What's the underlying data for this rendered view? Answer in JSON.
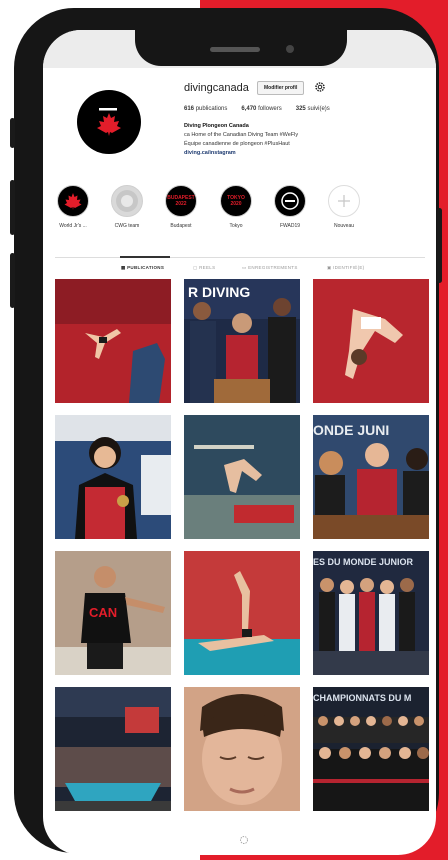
{
  "profile": {
    "username": "divingcanada",
    "edit_button": "Modifier profil",
    "stats": {
      "posts_count": "616",
      "posts_label": "publications",
      "followers_count": "6,470",
      "followers_label": "followers",
      "following_count": "325",
      "following_label": "suivi(e)s"
    },
    "bio": {
      "name": "Diving Plongeon Canada",
      "line1": "ca Home of the Canadian Diving Team #WeFly",
      "line2": "Équipe canadienne de plongeon #PlusHaut",
      "link": "diving.ca/instagram"
    }
  },
  "highlights": [
    {
      "label": "World Jr's ...",
      "icon": "maple-leaf"
    },
    {
      "label": "CWG team",
      "icon": "photo"
    },
    {
      "label": "Budapest",
      "icon": "text",
      "text": "BUDAPEST 2022"
    },
    {
      "label": "Tokyo",
      "icon": "text",
      "text": "TOKYO 2020"
    },
    {
      "label": "FWAD19",
      "icon": "logo"
    },
    {
      "label": "Nouveau",
      "icon": "plus"
    }
  ],
  "tabs": [
    {
      "label": "PUBLICATIONS",
      "icon": "grid-icon",
      "active": true
    },
    {
      "label": "REELS",
      "icon": "reels-icon",
      "active": false
    },
    {
      "label": "ENREGISTREMENTS",
      "icon": "bookmark-icon",
      "active": false
    },
    {
      "label": "IDENTIFIÉ(E)",
      "icon": "tag-icon",
      "active": false
    }
  ],
  "posts": [
    {
      "name": "post-diver-platform",
      "bg": "#b3232b"
    },
    {
      "name": "post-medal-trio",
      "bg": "#1e2a46"
    },
    {
      "name": "post-diver-pike",
      "bg": "#b8262e"
    },
    {
      "name": "post-girl-medal",
      "bg": "#2c4b79"
    },
    {
      "name": "post-diver-springboard",
      "bg": "#2e4a5e"
    },
    {
      "name": "post-girls-podium",
      "bg": "#30496e"
    },
    {
      "name": "post-can-shirt",
      "bg": "#b59e8a"
    },
    {
      "name": "post-diver-pool",
      "bg": "#c43a3a"
    },
    {
      "name": "post-team-group",
      "bg": "#20293f"
    },
    {
      "name": "post-aquatic-centre",
      "bg": "#1d2433"
    },
    {
      "name": "post-portrait",
      "bg": "#d2a386"
    },
    {
      "name": "post-team-photo",
      "bg": "#1b2230"
    }
  ],
  "colors": {
    "brand_red": "#e31d2a",
    "link_blue": "#1d3a70"
  }
}
